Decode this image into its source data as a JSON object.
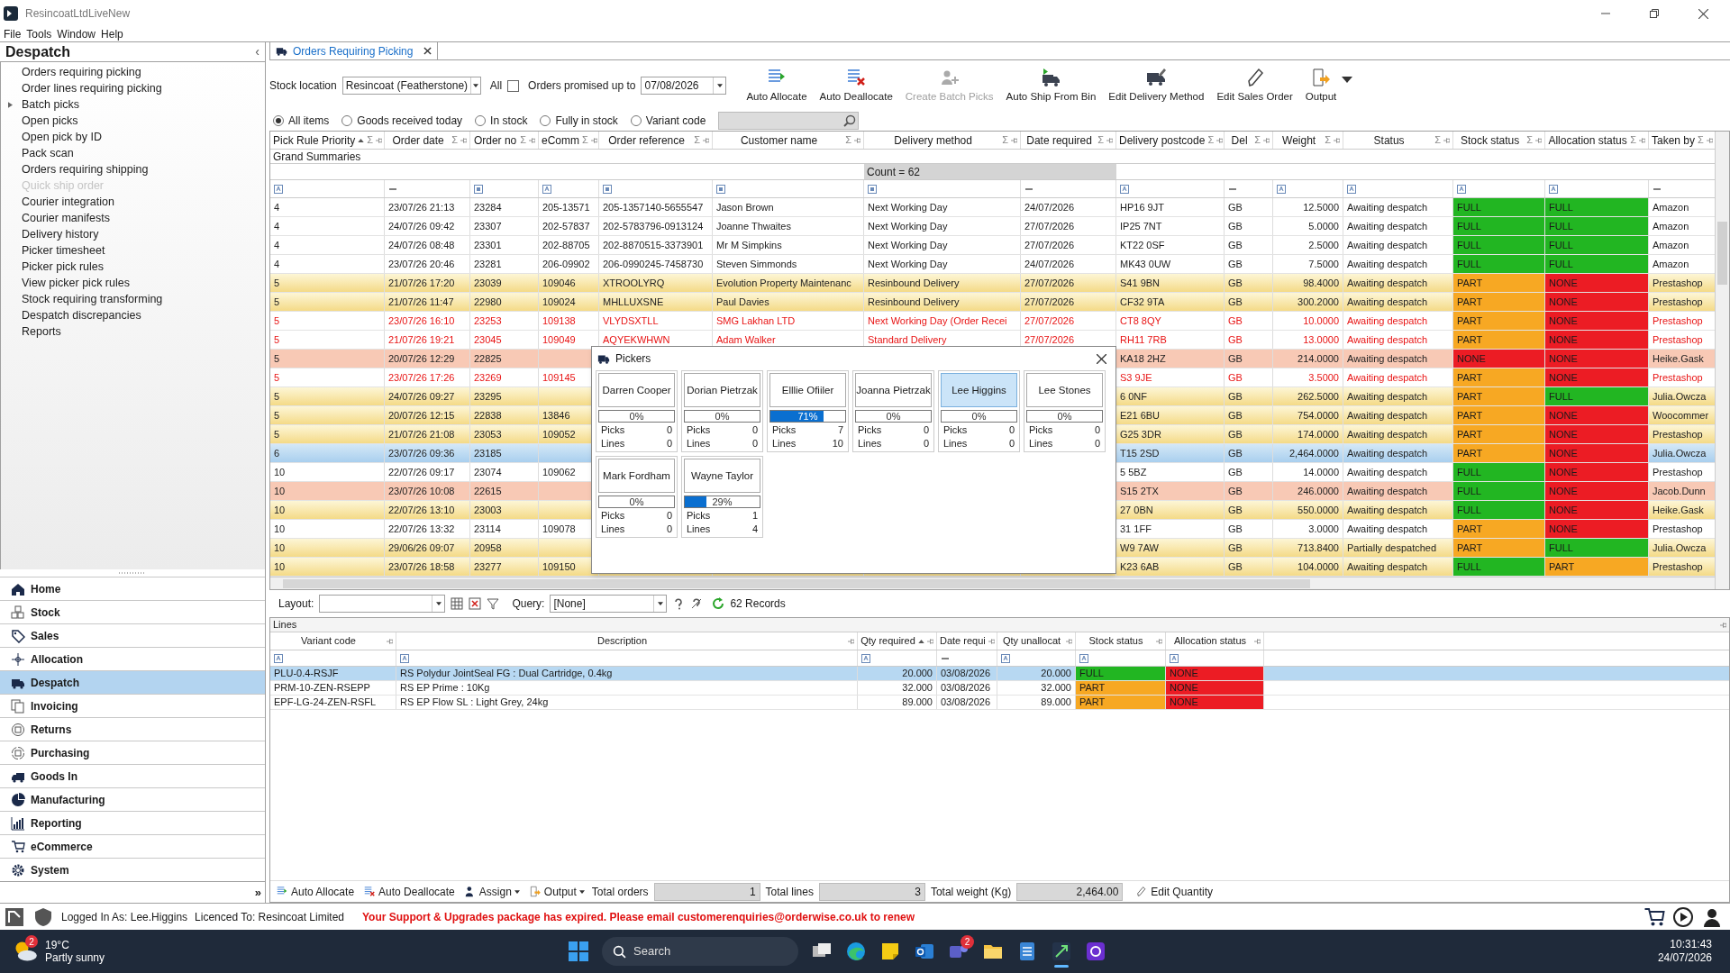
{
  "window": {
    "title": "ResincoatLtdLiveNew"
  },
  "menu": [
    "File",
    "Tools",
    "Window",
    "Help"
  ],
  "sidebar": {
    "title": "Despatch",
    "collapse": "‹",
    "items": [
      {
        "label": "Orders requiring picking",
        "kind": "leaf",
        "disabled": false
      },
      {
        "label": "Order lines requiring picking",
        "kind": "leaf",
        "disabled": false
      },
      {
        "label": "Batch picks",
        "kind": "group",
        "disabled": false
      },
      {
        "label": "Open picks",
        "kind": "leaf",
        "disabled": false
      },
      {
        "label": "Open pick by ID",
        "kind": "leaf",
        "disabled": false
      },
      {
        "label": "Pack scan",
        "kind": "leaf",
        "disabled": false
      },
      {
        "label": "Orders requiring shipping",
        "kind": "leaf",
        "disabled": false
      },
      {
        "label": "Quick ship order",
        "kind": "leaf",
        "disabled": true
      },
      {
        "label": "Courier integration",
        "kind": "leaf",
        "disabled": false
      },
      {
        "label": "Courier manifests",
        "kind": "leaf",
        "disabled": false
      },
      {
        "label": "Delivery history",
        "kind": "leaf",
        "disabled": false
      },
      {
        "label": "Picker timesheet",
        "kind": "leaf",
        "disabled": false
      },
      {
        "label": "Picker pick rules",
        "kind": "leaf",
        "disabled": false
      },
      {
        "label": "View picker pick rules",
        "kind": "leaf",
        "disabled": false
      },
      {
        "label": "Stock requiring transforming",
        "kind": "leaf",
        "disabled": false
      },
      {
        "label": "Despatch discrepancies",
        "kind": "leaf",
        "disabled": false
      },
      {
        "label": "Reports",
        "kind": "leaf",
        "disabled": false
      }
    ],
    "nav": [
      {
        "label": "Home",
        "selected": false
      },
      {
        "label": "Stock",
        "selected": false
      },
      {
        "label": "Sales",
        "selected": false
      },
      {
        "label": "Allocation",
        "selected": false
      },
      {
        "label": "Despatch",
        "selected": true
      },
      {
        "label": "Invoicing",
        "selected": false
      },
      {
        "label": "Returns",
        "selected": false
      },
      {
        "label": "Purchasing",
        "selected": false
      },
      {
        "label": "Goods In",
        "selected": false
      },
      {
        "label": "Manufacturing",
        "selected": false
      },
      {
        "label": "Reporting",
        "selected": false
      },
      {
        "label": "eCommerce",
        "selected": false
      },
      {
        "label": "System",
        "selected": false
      }
    ],
    "more": "»"
  },
  "tabs": [
    {
      "label": "Orders Requiring Picking",
      "selected": true
    }
  ],
  "filters": {
    "stock_location_label": "Stock location",
    "stock_location": "Resincoat (Featherstone)",
    "all_label": "All",
    "all_checked": false,
    "promised_label": "Orders promised up to",
    "promised_date": "07/08/2026"
  },
  "toolbar": [
    {
      "label": "Auto Allocate",
      "disabled": false,
      "dropdown": false
    },
    {
      "label": "Auto Deallocate",
      "disabled": false,
      "dropdown": false
    },
    {
      "label": "Create Batch Picks",
      "disabled": true,
      "dropdown": false
    },
    {
      "label": "Auto Ship From Bin",
      "disabled": false,
      "dropdown": false
    },
    {
      "label": "Edit Delivery Method",
      "disabled": false,
      "dropdown": false
    },
    {
      "label": "Edit Sales Order",
      "disabled": false,
      "dropdown": false
    },
    {
      "label": "Output",
      "disabled": false,
      "dropdown": true
    }
  ],
  "radios": [
    {
      "label": "All items",
      "selected": true
    },
    {
      "label": "Goods received today",
      "selected": false
    },
    {
      "label": "In stock",
      "selected": false
    },
    {
      "label": "Fully in stock",
      "selected": false
    },
    {
      "label": "Variant code",
      "selected": false
    }
  ],
  "grid": {
    "grand_summaries": "Grand Summaries",
    "count": "Count = 62",
    "columns": [
      {
        "label": "Pick Rule Priority",
        "sorted": true,
        "sum": "Σ"
      },
      {
        "label": "Order date",
        "sorted": false,
        "sum": "Σ"
      },
      {
        "label": "Order no",
        "sorted": false,
        "sum": "Σ"
      },
      {
        "label": "eComm",
        "sorted": false,
        "sum": "Σ"
      },
      {
        "label": "Order reference",
        "sorted": false,
        "sum": "Σ"
      },
      {
        "label": "Customer name",
        "sorted": false,
        "sum": "Σ"
      },
      {
        "label": "Delivery method",
        "sorted": false,
        "sum": "Σ"
      },
      {
        "label": "Date required",
        "sorted": false,
        "sum": "Σ"
      },
      {
        "label": "Delivery postcode",
        "sorted": false,
        "sum": "Σ"
      },
      {
        "label": "Del",
        "sorted": false,
        "sum": "Σ"
      },
      {
        "label": "Weight",
        "sorted": false,
        "sum": "Σ"
      },
      {
        "label": "Status",
        "sorted": false,
        "sum": "Σ"
      },
      {
        "label": "Stock status",
        "sorted": false,
        "sum": "Σ"
      },
      {
        "label": "Allocation status",
        "sorted": false,
        "sum": "Σ"
      },
      {
        "label": "Taken by",
        "sorted": false,
        "sum": "Σ"
      }
    ],
    "rows": [
      {
        "kind": "plain",
        "text_red": false,
        "selected": false,
        "priority": "4",
        "order_date": "23/07/26 21:13",
        "order_no": "23284",
        "ecomm": "205-13571",
        "order_reference": "205-1357140-5655547",
        "customer_name": "Jason Brown",
        "delivery_method": "Next Working Day",
        "date_required": "24/07/2026",
        "postcode": "HP16 9JT",
        "country": "GB",
        "weight": "12.5000",
        "status": "Awaiting despatch",
        "stock_status": {
          "text": "FULL",
          "color": "#22b622"
        },
        "allocation_status": {
          "text": "FULL",
          "color": "#22b622"
        },
        "taken_by": "Amazon"
      },
      {
        "kind": "plain",
        "text_red": false,
        "selected": false,
        "priority": "4",
        "order_date": "24/07/26 09:42",
        "order_no": "23307",
        "ecomm": "202-57837",
        "order_reference": "202-5783796-0913124",
        "customer_name": "Joanne Thwaites",
        "delivery_method": "Next Working Day",
        "date_required": "27/07/2026",
        "postcode": "IP25 7NT",
        "country": "GB",
        "weight": "5.0000",
        "status": "Awaiting despatch",
        "stock_status": {
          "text": "FULL",
          "color": "#22b622"
        },
        "allocation_status": {
          "text": "FULL",
          "color": "#22b622"
        },
        "taken_by": "Amazon"
      },
      {
        "kind": "plain",
        "text_red": false,
        "selected": false,
        "priority": "4",
        "order_date": "24/07/26 08:48",
        "order_no": "23301",
        "ecomm": "202-88705",
        "order_reference": "202-8870515-3373901",
        "customer_name": "Mr M Simpkins",
        "delivery_method": "Next Working Day",
        "date_required": "27/07/2026",
        "postcode": "KT22 0SF",
        "country": "GB",
        "weight": "2.5000",
        "status": "Awaiting despatch",
        "stock_status": {
          "text": "FULL",
          "color": "#22b622"
        },
        "allocation_status": {
          "text": "FULL",
          "color": "#22b622"
        },
        "taken_by": "Amazon"
      },
      {
        "kind": "plain",
        "text_red": false,
        "selected": false,
        "priority": "4",
        "order_date": "23/07/26 20:46",
        "order_no": "23281",
        "ecomm": "206-09902",
        "order_reference": "206-0990245-7458730",
        "customer_name": "Steven Simmonds",
        "delivery_method": "Next Working Day",
        "date_required": "24/07/2026",
        "postcode": "MK43 0UW",
        "country": "GB",
        "weight": "7.5000",
        "status": "Awaiting despatch",
        "stock_status": {
          "text": "FULL",
          "color": "#22b622"
        },
        "allocation_status": {
          "text": "FULL",
          "color": "#22b622"
        },
        "taken_by": "Amazon"
      },
      {
        "kind": "yellow",
        "text_red": false,
        "selected": false,
        "priority": "5",
        "order_date": "21/07/26 17:20",
        "order_no": "23039",
        "ecomm": "109046",
        "order_reference": "XTROOLYRQ",
        "customer_name": "Evolution Property Maintenanc",
        "delivery_method": "Resinbound Delivery",
        "date_required": "27/07/2026",
        "postcode": "S41 9BN",
        "country": "GB",
        "weight": "98.4000",
        "status": "Awaiting despatch",
        "stock_status": {
          "text": "PART",
          "color": "#f7a823"
        },
        "allocation_status": {
          "text": "NONE",
          "color": "#ec1c24"
        },
        "taken_by": "Prestashop"
      },
      {
        "kind": "yellow",
        "text_red": false,
        "selected": false,
        "priority": "5",
        "order_date": "21/07/26 11:47",
        "order_no": "22980",
        "ecomm": "109024",
        "order_reference": "MHLLUXSNE",
        "customer_name": "Paul Davies",
        "delivery_method": "Resinbound Delivery",
        "date_required": "27/07/2026",
        "postcode": "CF32 9TA",
        "country": "GB",
        "weight": "300.2000",
        "status": "Awaiting despatch",
        "stock_status": {
          "text": "PART",
          "color": "#f7a823"
        },
        "allocation_status": {
          "text": "NONE",
          "color": "#ec1c24"
        },
        "taken_by": "Prestashop"
      },
      {
        "kind": "plain",
        "text_red": true,
        "selected": false,
        "priority": "5",
        "order_date": "23/07/26 16:10",
        "order_no": "23253",
        "ecomm": "109138",
        "order_reference": "VLYDSXTLL",
        "customer_name": "SMG Lakhan LTD",
        "delivery_method": "Next Working Day (Order Recei",
        "date_required": "27/07/2026",
        "postcode": "CT8 8QY",
        "country": "GB",
        "weight": "10.0000",
        "status": "Awaiting despatch",
        "stock_status": {
          "text": "PART",
          "color": "#f7a823"
        },
        "allocation_status": {
          "text": "NONE",
          "color": "#ec1c24"
        },
        "taken_by": "Prestashop"
      },
      {
        "kind": "plain",
        "text_red": true,
        "selected": false,
        "priority": "5",
        "order_date": "21/07/26 19:21",
        "order_no": "23045",
        "ecomm": "109049",
        "order_reference": "AQYEKWHWN",
        "customer_name": "Adam Walker",
        "delivery_method": "Standard Delivery",
        "date_required": "27/07/2026",
        "postcode": "RH11 7RB",
        "country": "GB",
        "weight": "13.0000",
        "status": "Awaiting despatch",
        "stock_status": {
          "text": "PART",
          "color": "#f7a823"
        },
        "allocation_status": {
          "text": "NONE",
          "color": "#ec1c24"
        },
        "taken_by": "Prestashop"
      },
      {
        "kind": "salmon",
        "text_red": false,
        "selected": false,
        "priority": "5",
        "order_date": "20/07/26 12:29",
        "order_no": "22825",
        "postcode": "KA18 2HZ",
        "country": "GB",
        "weight": "214.0000",
        "status": "Awaiting despatch",
        "stock_status": {
          "text": "NONE",
          "color": "#ec1c24"
        },
        "allocation_status": {
          "text": "NONE",
          "color": "#ec1c24"
        },
        "taken_by": "Heike.Gask"
      },
      {
        "kind": "plain",
        "text_red": true,
        "selected": false,
        "priority": "5",
        "order_date": "23/07/26 17:26",
        "order_no": "23269",
        "ecomm": "109145",
        "postcode": "S3 9JE",
        "country": "GB",
        "weight": "3.5000",
        "status": "Awaiting despatch",
        "stock_status": {
          "text": "PART",
          "color": "#f7a823"
        },
        "allocation_status": {
          "text": "NONE",
          "color": "#ec1c24"
        },
        "taken_by": "Prestashop"
      },
      {
        "kind": "yellow",
        "text_red": false,
        "selected": false,
        "priority": "5",
        "order_date": "24/07/26 09:27",
        "order_no": "23295",
        "postcode": "6 0NF",
        "country": "GB",
        "weight": "262.5000",
        "status": "Awaiting despatch",
        "stock_status": {
          "text": "PART",
          "color": "#f7a823"
        },
        "allocation_status": {
          "text": "FULL",
          "color": "#22b622"
        },
        "taken_by": "Julia.Owcza"
      },
      {
        "kind": "yellow",
        "text_red": false,
        "selected": false,
        "priority": "5",
        "order_date": "20/07/26 12:15",
        "order_no": "22838",
        "ecomm": "13846",
        "postcode": "E21 6BU",
        "country": "GB",
        "weight": "754.0000",
        "status": "Awaiting despatch",
        "stock_status": {
          "text": "PART",
          "color": "#f7a823"
        },
        "allocation_status": {
          "text": "NONE",
          "color": "#ec1c24"
        },
        "taken_by": "Woocommer"
      },
      {
        "kind": "yellow",
        "text_red": false,
        "selected": false,
        "priority": "5",
        "order_date": "21/07/26 21:08",
        "order_no": "23053",
        "ecomm": "109052",
        "postcode": "G25 3DR",
        "country": "GB",
        "weight": "174.0000",
        "status": "Awaiting despatch",
        "stock_status": {
          "text": "PART",
          "color": "#f7a823"
        },
        "allocation_status": {
          "text": "NONE",
          "color": "#ec1c24"
        },
        "taken_by": "Prestashop"
      },
      {
        "kind": "plain",
        "text_red": false,
        "selected": true,
        "priority": "6",
        "order_date": "23/07/26 09:36",
        "order_no": "23185",
        "postcode": "T15 2SD",
        "country": "GB",
        "weight": "2,464.0000",
        "status": "Awaiting despatch",
        "stock_status": {
          "text": "PART",
          "color": "#f7a823"
        },
        "allocation_status": {
          "text": "NONE",
          "color": "#ec1c24"
        },
        "taken_by": "Julia.Owcza"
      },
      {
        "kind": "plain",
        "text_red": false,
        "selected": false,
        "priority": "10",
        "order_date": "22/07/26 09:17",
        "order_no": "23074",
        "ecomm": "109062",
        "postcode": "5 5BZ",
        "country": "GB",
        "weight": "14.0000",
        "status": "Awaiting despatch",
        "stock_status": {
          "text": "FULL",
          "color": "#22b622"
        },
        "allocation_status": {
          "text": "NONE",
          "color": "#ec1c24"
        },
        "taken_by": "Prestashop"
      },
      {
        "kind": "salmon",
        "text_red": false,
        "selected": false,
        "priority": "10",
        "order_date": "23/07/26 10:08",
        "order_no": "22615",
        "postcode": "S15 2TX",
        "country": "GB",
        "weight": "246.0000",
        "status": "Awaiting despatch",
        "stock_status": {
          "text": "FULL",
          "color": "#22b622"
        },
        "allocation_status": {
          "text": "NONE",
          "color": "#ec1c24"
        },
        "taken_by": "Jacob.Dunn"
      },
      {
        "kind": "yellow",
        "text_red": false,
        "selected": false,
        "priority": "10",
        "order_date": "22/07/26 13:10",
        "order_no": "23003",
        "postcode": "27 0BN",
        "country": "GB",
        "weight": "550.0000",
        "status": "Awaiting despatch",
        "stock_status": {
          "text": "FULL",
          "color": "#22b622"
        },
        "allocation_status": {
          "text": "NONE",
          "color": "#ec1c24"
        },
        "taken_by": "Heike.Gask"
      },
      {
        "kind": "plain",
        "text_red": false,
        "selected": false,
        "priority": "10",
        "order_date": "22/07/26 13:32",
        "order_no": "23114",
        "ecomm": "109078",
        "postcode": "31 1FF",
        "country": "GB",
        "weight": "3.0000",
        "status": "Awaiting despatch",
        "stock_status": {
          "text": "PART",
          "color": "#f7a823"
        },
        "allocation_status": {
          "text": "NONE",
          "color": "#ec1c24"
        },
        "taken_by": "Prestashop"
      },
      {
        "kind": "yellow",
        "text_red": false,
        "selected": false,
        "priority": "10",
        "order_date": "29/06/26 09:07",
        "order_no": "20958",
        "postcode": "W9 7AW",
        "country": "GB",
        "weight": "713.8400",
        "status": "Partially despatched",
        "stock_status": {
          "text": "PART",
          "color": "#f7a823"
        },
        "allocation_status": {
          "text": "FULL",
          "color": "#22b622"
        },
        "taken_by": "Julia.Owcza"
      },
      {
        "kind": "yellow",
        "text_red": false,
        "selected": false,
        "priority": "10",
        "order_date": "23/07/26 18:58",
        "order_no": "23277",
        "ecomm": "109150",
        "postcode": "K23 6AB",
        "country": "GB",
        "weight": "104.0000",
        "status": "Awaiting despatch",
        "stock_status": {
          "text": "FULL",
          "color": "#22b622"
        },
        "allocation_status": {
          "text": "PART",
          "color": "#f7a823"
        },
        "taken_by": "Prestashop"
      }
    ]
  },
  "pickers_dialog": {
    "title": "Pickers",
    "pickers": [
      {
        "name": "Darren Cooper",
        "percent": "0%",
        "level": 0,
        "picks_label": "Picks",
        "picks": "0",
        "lines_label": "Lines",
        "lines": "0",
        "selected": false
      },
      {
        "name": "Dorian Pietrzak",
        "percent": "0%",
        "level": 0,
        "picks_label": "Picks",
        "picks": "0",
        "lines_label": "Lines",
        "lines": "0",
        "selected": false
      },
      {
        "name": "Elllie Ofiiler",
        "percent": "71%",
        "level": 0.71,
        "picks_label": "Picks",
        "picks": "7",
        "lines_label": "Lines",
        "lines": "10",
        "selected": false
      },
      {
        "name": "Joanna Pietrzak",
        "percent": "0%",
        "level": 0,
        "picks_label": "Picks",
        "picks": "0",
        "lines_label": "Lines",
        "lines": "0",
        "selected": false
      },
      {
        "name": "Lee Higgins",
        "percent": "0%",
        "level": 0,
        "picks_label": "Picks",
        "picks": "0",
        "lines_label": "Lines",
        "lines": "0",
        "selected": true
      },
      {
        "name": "Lee Stones",
        "percent": "0%",
        "level": 0,
        "picks_label": "Picks",
        "picks": "0",
        "lines_label": "Lines",
        "lines": "0",
        "selected": false
      },
      {
        "name": "Mark Fordham",
        "percent": "0%",
        "level": 0,
        "picks_label": "Picks",
        "picks": "0",
        "lines_label": "Lines",
        "lines": "0",
        "selected": false
      },
      {
        "name": "Wayne Taylor",
        "percent": "29%",
        "level": 0.29,
        "picks_label": "Picks",
        "picks": "1",
        "lines_label": "Lines",
        "lines": "4",
        "selected": false
      }
    ]
  },
  "layout_bar": {
    "layout_label": "Layout:",
    "query_label": "Query:",
    "query": "[None]",
    "records": "62 Records"
  },
  "lines": {
    "title": "Lines",
    "columns": [
      {
        "label": "Variant code",
        "sorted": false
      },
      {
        "label": "Description",
        "sorted": false
      },
      {
        "label": "Qty required",
        "sorted": true
      },
      {
        "label": "Date requi",
        "sorted": false
      },
      {
        "label": "Qty unallocat",
        "sorted": false
      },
      {
        "label": "Stock status",
        "sorted": false
      },
      {
        "label": "Allocation status",
        "sorted": false
      }
    ],
    "rows": [
      {
        "selected": true,
        "variant": "PLU-0.4-RSJF",
        "description": "RS Polydur JointSeal FG : Dual Cartridge, 0.4kg",
        "qty_required": "20.000",
        "date": "03/08/2026",
        "qty_unallocated": "20.000",
        "stock_status": {
          "text": "FULL",
          "color": "#22b622"
        },
        "allocation_status": {
          "text": "NONE",
          "color": "#ec1c24"
        }
      },
      {
        "selected": false,
        "variant": "PRM-10-ZEN-RSEPP",
        "description": "RS EP Prime : 10Kg",
        "qty_required": "32.000",
        "date": "03/08/2026",
        "qty_unallocated": "32.000",
        "stock_status": {
          "text": "PART",
          "color": "#f7a823"
        },
        "allocation_status": {
          "text": "NONE",
          "color": "#ec1c24"
        }
      },
      {
        "selected": false,
        "variant": "EPF-LG-24-ZEN-RSFL",
        "description": "RS EP Flow SL :  Light Grey, 24kg",
        "qty_required": "89.000",
        "date": "03/08/2026",
        "qty_unallocated": "89.000",
        "stock_status": {
          "text": "PART",
          "color": "#f7a823"
        },
        "allocation_status": {
          "text": "NONE",
          "color": "#ec1c24"
        }
      }
    ]
  },
  "bottom_toolbar": {
    "buttons": [
      {
        "label": "Auto Allocate",
        "dropdown": false
      },
      {
        "label": "Auto Deallocate",
        "dropdown": false
      },
      {
        "label": "Assign",
        "dropdown": true
      },
      {
        "label": "Output",
        "dropdown": true
      }
    ],
    "totals": [
      {
        "label": "Total orders",
        "value": "1"
      },
      {
        "label": "Total lines",
        "value": "3"
      },
      {
        "label": "Total weight (Kg)",
        "value": "2,464.00"
      }
    ],
    "edit_quantity": "Edit Quantity"
  },
  "status_bar": {
    "logged_in": "Logged In As: Lee.Higgins",
    "licence": "Licenced To: Resincoat Limited",
    "message": "Your Support & Upgrades package has expired. Please email customerenquiries@orderwise.co.uk to renew"
  },
  "taskbar": {
    "weather_badge": "2",
    "temperature": "19°C",
    "weather": "Partly sunny",
    "search": "Search",
    "chat_badge": "2",
    "time": "10:31:43",
    "date": "24/07/2026"
  }
}
